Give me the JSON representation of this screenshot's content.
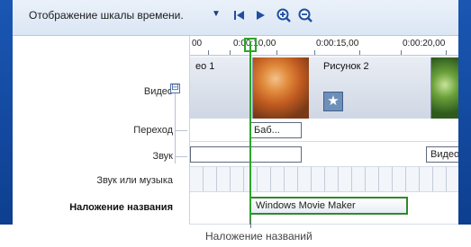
{
  "toolbar": {
    "view_label": "Отображение шкалы времени.",
    "dropdown_glyph": "▼",
    "buttons": [
      "rewind-icon",
      "play-icon",
      "zoom-in-icon",
      "zoom-out-icon"
    ]
  },
  "tracks": {
    "video": "Видео",
    "expand_glyph": "⊟",
    "transition": "Переход",
    "audio": "Звук",
    "music": "Звук или музыка",
    "title_overlay": "Наложение названия"
  },
  "ruler": {
    "ticks": [
      "00",
      "0:00:10,00",
      "0:00:15,00",
      "0:00:20,00"
    ]
  },
  "clips": {
    "video_1": "ео 1",
    "picture_2": "Рисунок 2",
    "transition": "Баб...",
    "audio_video": "Видео",
    "title": "Windows Movie Maker"
  },
  "callout": "Наложение названий",
  "colors": {
    "accent": "#2aa52a",
    "frame": "#1a57b3"
  }
}
